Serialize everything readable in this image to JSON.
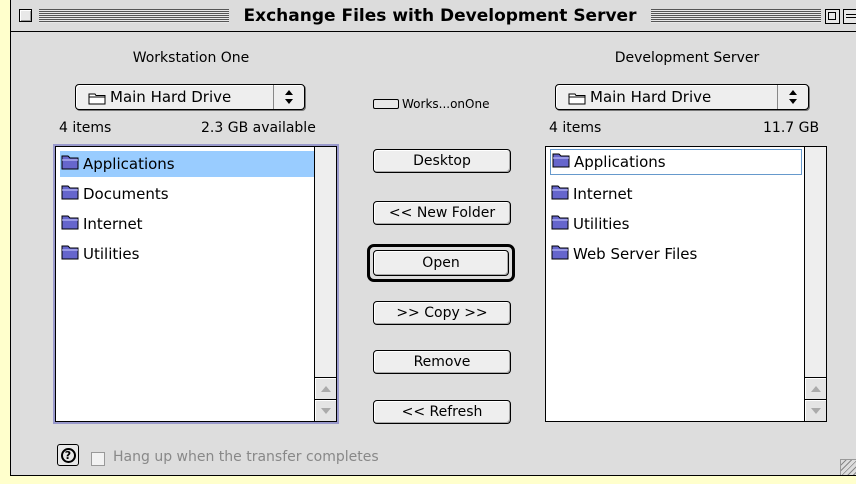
{
  "window": {
    "title": "Exchange Files with Development Server"
  },
  "left": {
    "title": "Workstation One",
    "volume": "Main Hard Drive",
    "item_count": "4 items",
    "space": "2.3 GB available",
    "items": [
      {
        "name": "Applications"
      },
      {
        "name": "Documents"
      },
      {
        "name": "Internet"
      },
      {
        "name": "Utilities"
      }
    ]
  },
  "right": {
    "title": "Development Server",
    "volume": "Main Hard Drive",
    "item_count": "4 items",
    "space": "11.7 GB",
    "items": [
      {
        "name": "Applications"
      },
      {
        "name": "Internet"
      },
      {
        "name": "Utilities"
      },
      {
        "name": "Web Server Files"
      }
    ]
  },
  "center": {
    "drive_label": "Works...onOne",
    "buttons": {
      "desktop": "Desktop",
      "new_folder": "<< New Folder",
      "open": "Open",
      "copy": ">> Copy >>",
      "remove": "Remove",
      "refresh": "<< Refresh"
    }
  },
  "footer": {
    "checkbox_label": "Hang up when the transfer completes",
    "checkbox_checked": false
  },
  "icons": {
    "folder": "folder-icon",
    "help": "help-icon",
    "drive": "drive-icon"
  },
  "colors": {
    "desktop": "#ffffcc",
    "selection": "#99ccff",
    "folder": "#6666cc"
  }
}
